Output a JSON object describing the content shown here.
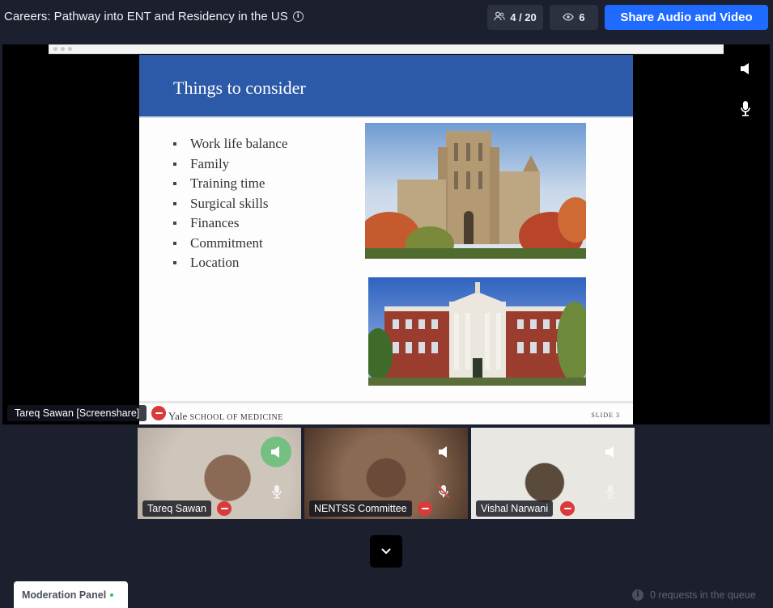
{
  "header": {
    "title": "Careers: Pathway into ENT and Residency in the US",
    "participants_count": "4 / 20",
    "viewers_count": "6",
    "share_button_label": "Share Audio and Video"
  },
  "stage": {
    "presenter_label": "Tareq Sawan [Screenshare]",
    "slide": {
      "title": "Things to consider",
      "bullets": [
        "Work life balance",
        "Family",
        "Training time",
        "Surgical skills",
        "Finances",
        "Commitment",
        "Location"
      ],
      "footer_logo_main": "Yale",
      "footer_logo_sub": "SCHOOL OF MEDICINE",
      "slide_number": "SLIDE 3"
    }
  },
  "tiles": [
    {
      "name": "Tareq Sawan",
      "speaking": true,
      "muted": false
    },
    {
      "name": "NENTSS Committee",
      "speaking": false,
      "muted": true
    },
    {
      "name": "Vishal Narwani",
      "speaking": false,
      "muted": false
    }
  ],
  "footer": {
    "moderation_label": "Moderation Panel",
    "queue_text": "0 requests in the queue"
  },
  "colors": {
    "background": "#1b1f2e",
    "accent": "#1f6bff",
    "remove": "#d93a3a",
    "slide_header": "#2d5aa8"
  }
}
